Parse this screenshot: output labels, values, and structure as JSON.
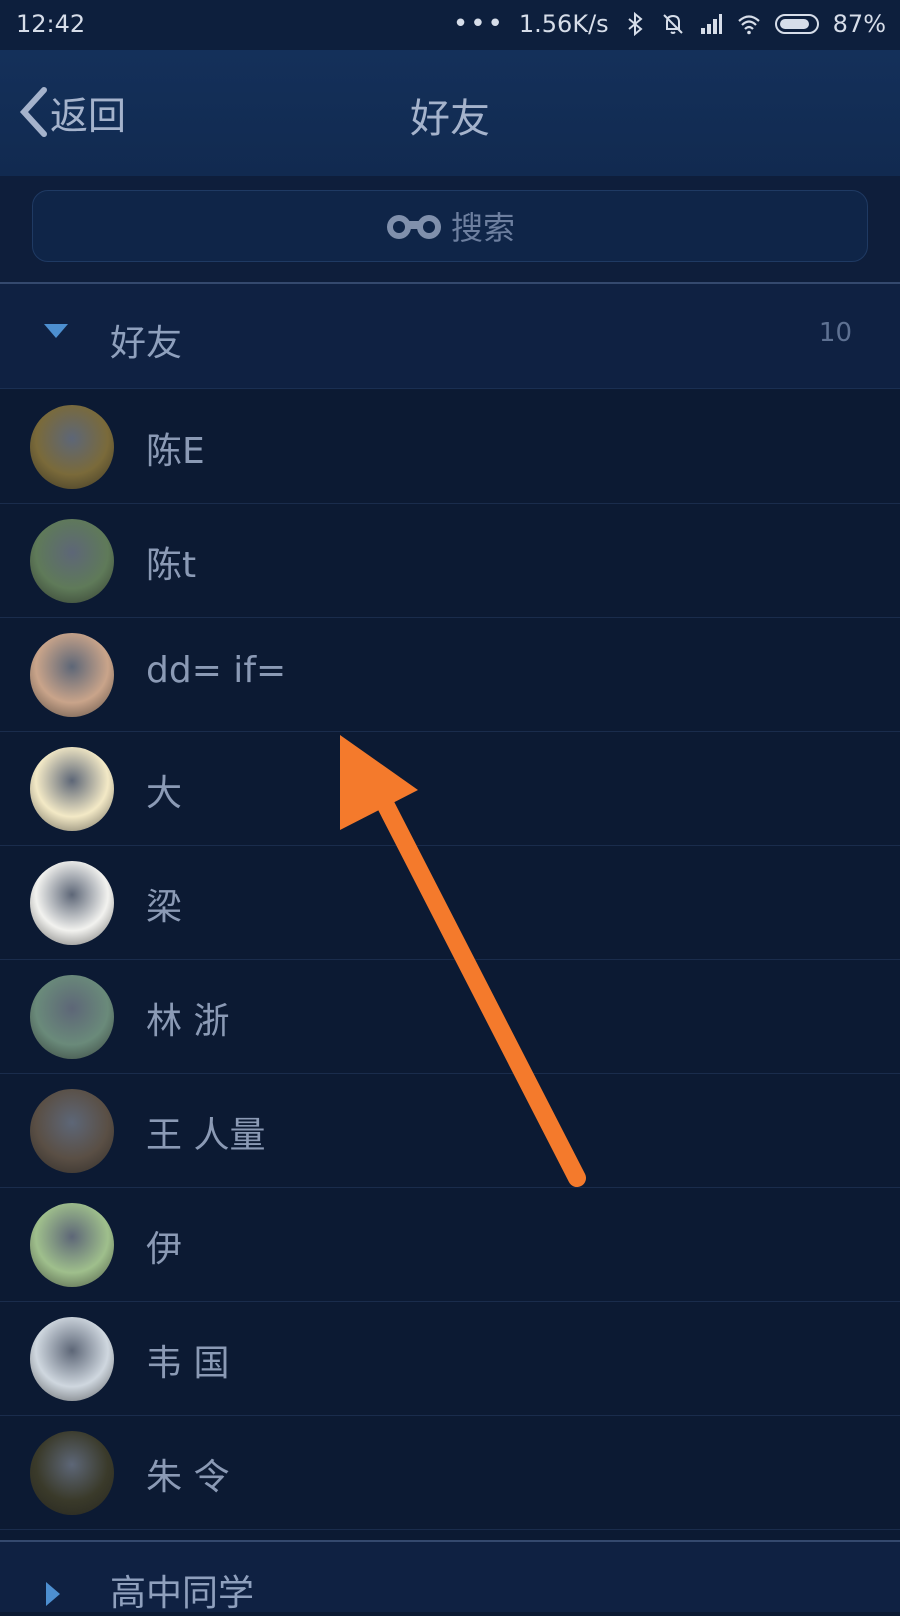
{
  "status_bar": {
    "time": "12:42",
    "dots": "•••",
    "network_speed": "1.56K/s",
    "battery_percent": "87%",
    "icons": [
      "bluetooth-icon",
      "mute-icon",
      "signal-icon",
      "wifi-icon",
      "battery-icon"
    ],
    "battery_level": 0.87
  },
  "nav": {
    "back_label": "返回",
    "title": "好友"
  },
  "search": {
    "label": "搜索",
    "icon": "binoculars-icon"
  },
  "group": {
    "title": "好友",
    "count": "10",
    "expanded": true
  },
  "friends": [
    {
      "name": "陈E",
      "avatar_color": "#7a6a3a"
    },
    {
      "name": "陈t",
      "avatar_color": "#5f7a59"
    },
    {
      "name": "dd=  if=",
      "avatar_color": "#c9a48a"
    },
    {
      "name": "大 ",
      "avatar_color": "#f3e9c6"
    },
    {
      "name": "梁  ",
      "avatar_color": "#f2f2ef"
    },
    {
      "name": "林 浙",
      "avatar_color": "#6a8a7a"
    },
    {
      "name": "王 人量",
      "avatar_color": "#5a4f45"
    },
    {
      "name": "伊",
      "avatar_color": "#9fbf8c"
    },
    {
      "name": "韦 国",
      "avatar_color": "#cfd7df"
    },
    {
      "name": "朱 令",
      "avatar_color": "#3a3a2a"
    }
  ],
  "group2": {
    "title": "高中同学"
  },
  "colors": {
    "background": "#0c1a33",
    "nav_bg": "#14305a",
    "annotation_arrow": "#f47a2c"
  }
}
